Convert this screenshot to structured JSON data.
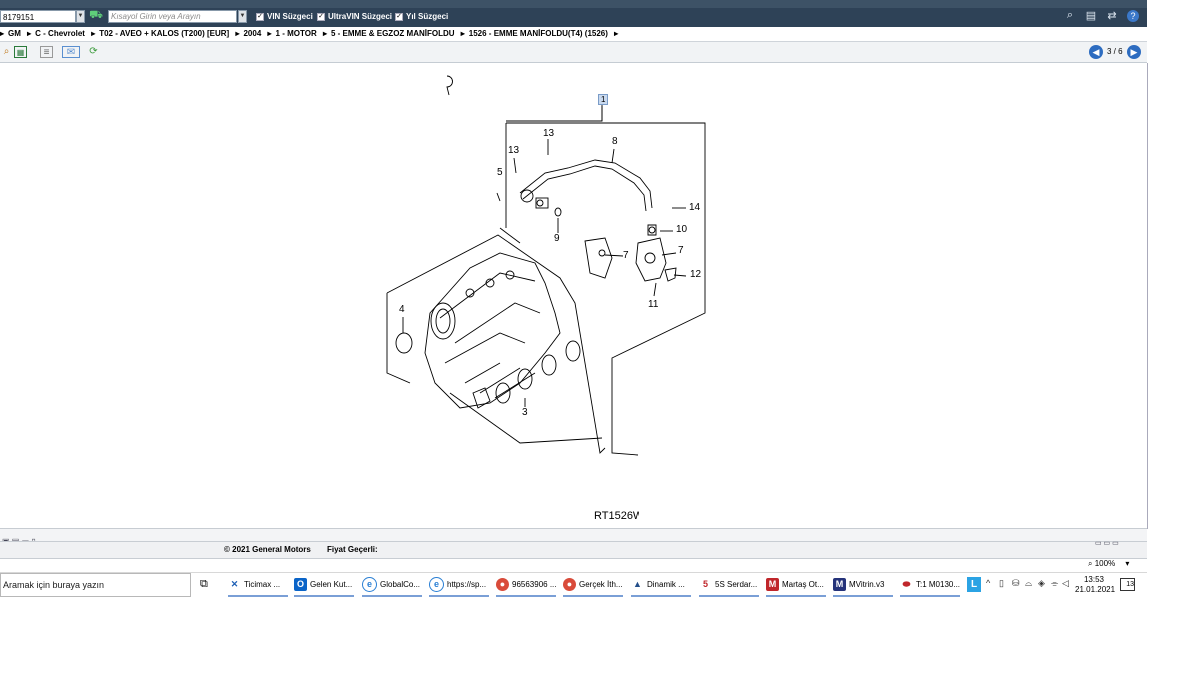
{
  "toolbar": {
    "vin_value": "8179151",
    "search_placeholder": "Kısayol Girin veya Arayın",
    "filters": [
      "VIN Süzgeci",
      "UltraVIN Süzgeci",
      "Yıl Süzgeci"
    ]
  },
  "breadcrumb": [
    "GM",
    "C - Chevrolet",
    "T02 - AVEO + KALOS (T200) [EUR]",
    "2004",
    "1 - MOTOR",
    "5 - EMME & EGZOZ MANİFOLDU",
    "1526 - EMME MANİFOLDU(T4)  (1526)"
  ],
  "pager": {
    "text": "3 / 6"
  },
  "diagram": {
    "code": "RT1526W",
    "callouts": [
      "1",
      "13",
      "8",
      "13",
      "5",
      "14",
      "10",
      "9",
      "7",
      "7",
      "12",
      "11",
      "4",
      "3"
    ]
  },
  "footer": {
    "copyright": "© 2021 General Motors",
    "price_label": "Fiyat Geçerli:"
  },
  "zoom": {
    "level": "100%"
  },
  "taskbar": {
    "search_placeholder": "Aramak için buraya yazın",
    "apps": [
      {
        "label": "Ticimax ...",
        "icon_color": "#1d5fb5"
      },
      {
        "label": "Gelen Kut...",
        "icon_color": "#0a64c8"
      },
      {
        "label": "GlobalCo...",
        "icon_color": "#2a7fd4"
      },
      {
        "label": "https://sp...",
        "icon_color": "#2a7fd4"
      },
      {
        "label": "96563906 ...",
        "icon_color": "#d94b3a"
      },
      {
        "label": "Gerçek İth...",
        "icon_color": "#d94b3a"
      },
      {
        "label": "Dinamik ...",
        "icon_color": "#234f8a"
      },
      {
        "label": "5S Serdar...",
        "icon_color": "#c0262b"
      },
      {
        "label": "Martaş Ot...",
        "icon_color": "#c0262b"
      },
      {
        "label": "MVitrin.v3",
        "icon_color": "#25337a"
      },
      {
        "label": "T:1 M0130...",
        "icon_color": "#c0262b"
      }
    ],
    "time": "13:53",
    "date": "21.01.2021",
    "notification_count": "13"
  }
}
